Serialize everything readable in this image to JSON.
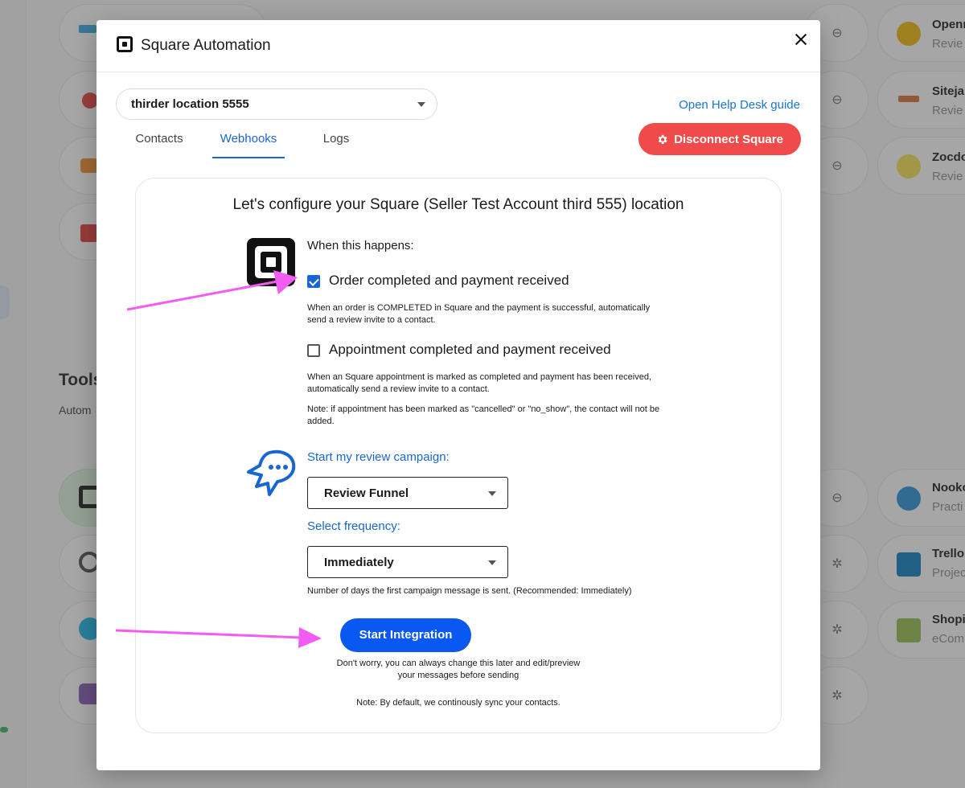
{
  "modal": {
    "title": "Square Automation",
    "location_value": "thirder location 5555",
    "help_link": "Open Help Desk guide",
    "tabs": [
      {
        "label": "Contacts",
        "active": false
      },
      {
        "label": "Webhooks",
        "active": true
      },
      {
        "label": "Logs",
        "active": false
      }
    ],
    "disconnect_label": "Disconnect Square",
    "heading": "Let's configure your Square (Seller Test Account third 555) location",
    "when_label": "When this happens:",
    "options": [
      {
        "label": "Order completed and payment received",
        "checked": true,
        "description": "When an order is COMPLETED in Square and the payment is successful, automatically send a review invite to a contact."
      },
      {
        "label": "Appointment completed and payment received",
        "checked": false,
        "description": "When an Square appointment is marked as completed and payment has been received, automatically send a review invite to a contact.",
        "note": "Note: if appointment has been marked as \"cancelled\" or \"no_show\", the contact will not be added."
      }
    ],
    "campaign_label": "Start my review campaign:",
    "campaign_value": "Review Funnel",
    "frequency_label": "Select frequency:",
    "frequency_value": "Immediately",
    "frequency_help": "Number of days the first campaign message is sent. (Recommended: Immediately)",
    "start_button": "Start Integration",
    "reassure_note": "Don't worry, you can always change this later and edit/preview your messages before sending",
    "sync_note": "Note: By default, we continously sync your contacts."
  },
  "background": {
    "tools_heading": "Tools",
    "tools_sub": "Autom",
    "right_cards": [
      {
        "title": "Openr",
        "sub": "Revie"
      },
      {
        "title": "Siteja",
        "sub": "Revie"
      },
      {
        "title": "Zocdo",
        "sub": "Revie"
      },
      {
        "title": "Nooko",
        "sub": "Practi"
      },
      {
        "title": "Trello",
        "sub": "Projec"
      },
      {
        "title": "Shopi",
        "sub": "eCom"
      }
    ]
  },
  "colors": {
    "accent_blue": "#1966d2",
    "primary_button": "#0a58f2",
    "danger_button": "#f14a4a",
    "annotation_arrow": "#f25cf2"
  }
}
